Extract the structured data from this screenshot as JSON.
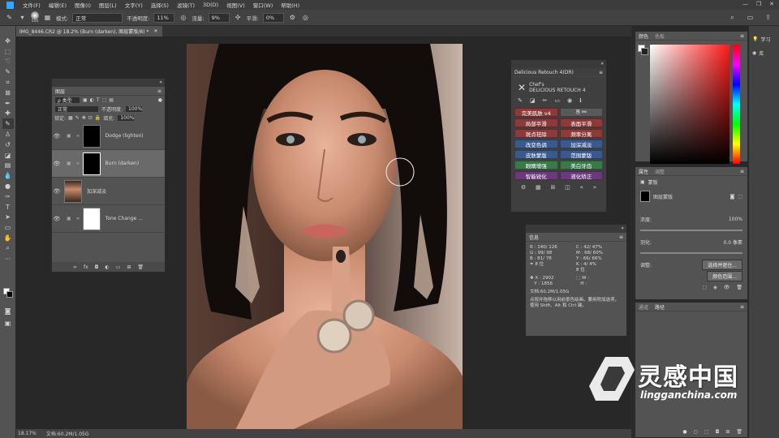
{
  "menubar": {
    "items": [
      "文件(F)",
      "编辑(E)",
      "图像(I)",
      "图层(L)",
      "文字(Y)",
      "选择(S)",
      "滤镜(T)",
      "3D(D)",
      "视图(V)",
      "窗口(W)",
      "帮助(H)"
    ]
  },
  "options": {
    "brush_size": "500",
    "mode_label": "模式:",
    "mode_value": "正常",
    "opacity_label": "不透明度:",
    "opacity_value": "11%",
    "flow_label": "流量:",
    "flow_value": "9%",
    "smooth_label": "平滑:",
    "smooth_value": "0%"
  },
  "document": {
    "tab_title": "IMG_8446.CR2 @ 18.2% (Burn (darken), 图层蒙版/8) *"
  },
  "status": {
    "zoom": "18.17%",
    "doc_info": "文档:60.2M/1.05G"
  },
  "layers_panel": {
    "title": "图层",
    "filter_kind": "ρ 类型",
    "blend_mode": "正常",
    "opacity_label": "不透明度:",
    "opacity_value": "100%",
    "lock_label": "锁定:",
    "fill_label": "填充:",
    "fill_value": "100%",
    "layers": [
      {
        "name": "Dodge (lighten)",
        "thumb": "black"
      },
      {
        "name": "Burn (darken)",
        "thumb": "black",
        "selected": true
      },
      {
        "name": "加深减淡",
        "thumb": "photo"
      },
      {
        "name": "Tone Change ...",
        "thumb": "white"
      }
    ],
    "footer_icons": [
      "link-icon",
      "fx-icon",
      "mask-icon",
      "adjustment-icon",
      "folder-icon",
      "new-layer-icon",
      "trash-icon"
    ]
  },
  "retouch_panel": {
    "title": "Delicious Retouch 4(DR)",
    "logo_line1": "Chef's",
    "logo_line2": "DELICIOUS RETOUCH 4",
    "buttons": [
      {
        "label": "完美肌肤 ⅴ4",
        "color": "#8e3a3a"
      },
      {
        "label": "",
        "color": "#5a5a5a"
      },
      {
        "label": "局部平滑",
        "color": "#8e3a3a"
      },
      {
        "label": "表面平滑",
        "color": "#8e3a3a"
      },
      {
        "label": "斑点祛除",
        "color": "#8e3a3a"
      },
      {
        "label": "频率分离",
        "color": "#8e3a3a"
      },
      {
        "label": "改变色调",
        "color": "#3a5a8e"
      },
      {
        "label": "加深减淡",
        "color": "#3a5a8e"
      },
      {
        "label": "皮肤蒙版",
        "color": "#3a5a8e"
      },
      {
        "label": "范围蒙版",
        "color": "#3a5a8e"
      },
      {
        "label": "眼睛增强",
        "color": "#3a7a4a"
      },
      {
        "label": "美白牙齿",
        "color": "#3a7a4a"
      },
      {
        "label": "智能锐化",
        "color": "#6a3a7a"
      },
      {
        "label": "液化矫正",
        "color": "#6a3a7a"
      }
    ]
  },
  "info_panel": {
    "title": "信息",
    "r": "R :",
    "r_val": "140/ 126",
    "g": "G :",
    "g_val": "99/ 98",
    "b": "B :",
    "b_val": "81/ 78",
    "bits_left": "8 位",
    "c": "C :",
    "c_val": "42/ 47%",
    "m": "M :",
    "m_val": "68/ 60%",
    "y": "Y :",
    "y_val": "66/ 66%",
    "k": "K :",
    "k_val": "4/ 4%",
    "bits_right": "8 位",
    "x": "X :",
    "x_val": "2902",
    "yy": "Y :",
    "yy_val": "1856",
    "w": "W :",
    "h": "H :",
    "doc": "文档:60.2M/1.05G",
    "hint": "点按并拖移以用前景色绘画。要用附加选项，使用 Shift、Alt 和 Ctrl 键。"
  },
  "color_panel": {
    "tab1": "颜色",
    "tab2": "色板"
  },
  "properties_panel": {
    "tab1": "属性",
    "tab2": "调整",
    "mask_label": "蒙版",
    "layer_mask": "图层蒙版",
    "density_label": "浓度:",
    "density_value": "100%",
    "feather_label": "羽化:",
    "feather_value": "0.0 像素",
    "adjust_label": "调整:",
    "select_btn": "选择并遮住...",
    "range_btn": "颜色范围..."
  },
  "paths_panel": {
    "tab1": "通道",
    "tab2": "路径"
  },
  "right_strip": {
    "learn": "学习",
    "library": "库"
  },
  "watermark": {
    "cn": "灵感中国",
    "en": "lingganchina.com"
  }
}
